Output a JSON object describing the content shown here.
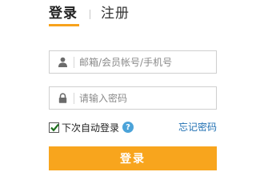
{
  "tabs": {
    "login": "登录",
    "register": "注册"
  },
  "username": {
    "placeholder": "邮箱/会员帐号/手机号",
    "icon": "user-icon"
  },
  "password": {
    "placeholder": "请输入密码",
    "icon": "lock-icon"
  },
  "remember": {
    "label": "下次自动登录",
    "checked": true,
    "help_symbol": "?"
  },
  "forgot": {
    "label": "忘记密码"
  },
  "submit": {
    "label": "登录"
  },
  "colors": {
    "accent": "#f8a51d",
    "link": "#1f6fb2",
    "help": "#4ba3d9"
  }
}
